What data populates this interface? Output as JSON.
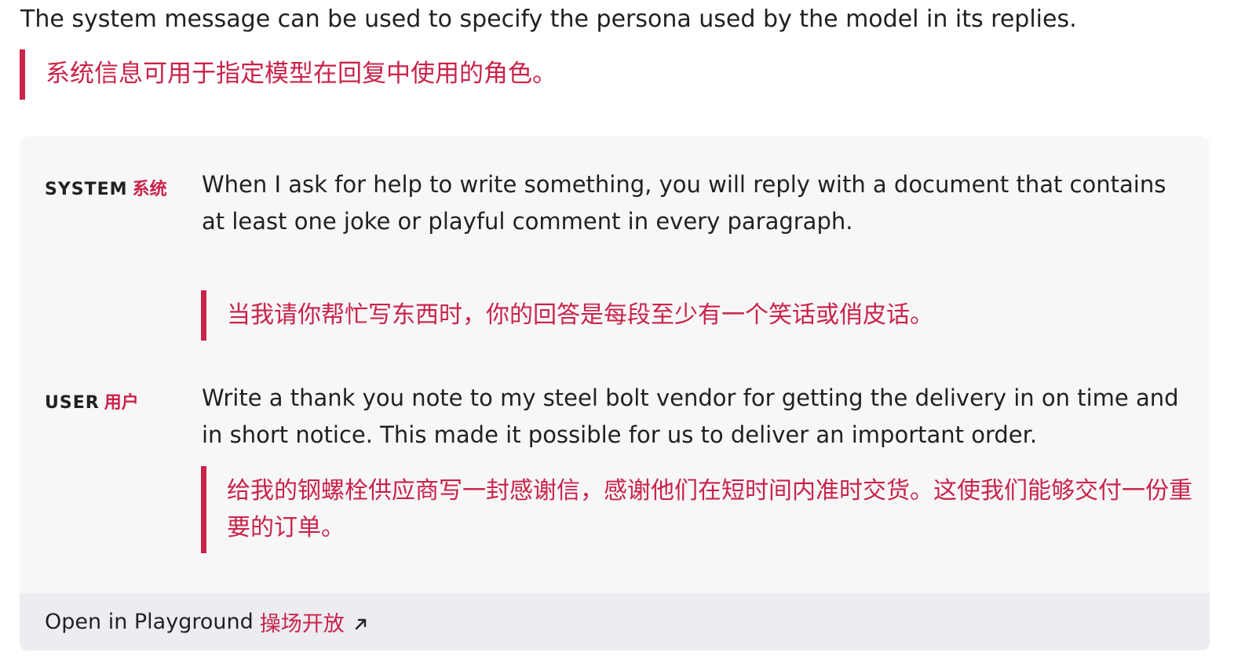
{
  "intro": {
    "text": "The system message can be used to specify the persona used by the model in its replies.",
    "translation": "系统信息可用于指定模型在回复中使用的角色。"
  },
  "example": {
    "system": {
      "role_label": "SYSTEM",
      "role_label_cn": "系统",
      "message": "When I ask for help to write something, you will reply with a document that contains at least one joke or playful comment in every paragraph.",
      "translation": "当我请你帮忙写东西时，你的回答是每段至少有一个笑话或俏皮话。"
    },
    "user": {
      "role_label": "USER",
      "role_label_cn": "用户",
      "message": "Write a thank you note to my steel bolt vendor for getting the delivery in on time and in short notice. This made it possible for us to deliver an important order.",
      "translation": "给我的钢螺栓供应商写一封感谢信，感谢他们在短时间内准时交货。这使我们能够交付一份重要的订单。"
    },
    "footer": {
      "link_label": "Open in Playground",
      "link_label_cn": "操场开放",
      "icon": "external-link-arrow-icon"
    }
  },
  "colors": {
    "accent": "#c9234a",
    "card_bg": "#f7f7f8",
    "footer_bg": "#ececf1",
    "text": "#202123"
  }
}
